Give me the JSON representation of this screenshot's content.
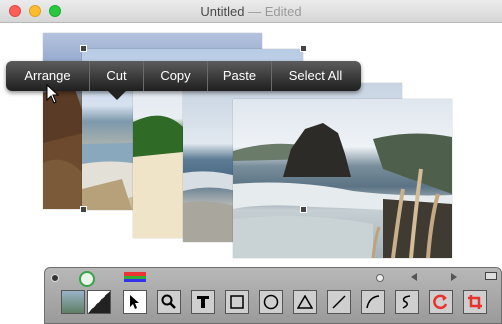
{
  "window": {
    "title": "Untitled",
    "separator": "—",
    "status": "Edited"
  },
  "context_menu": {
    "items": [
      "Arrange",
      "Cut",
      "Copy",
      "Paste",
      "Select All"
    ]
  },
  "toolbox": {
    "tools": [
      "thumbnail",
      "fill-swatch",
      "pointer",
      "magnifier",
      "text",
      "rectangle",
      "oval",
      "triangle",
      "line",
      "arc",
      "freehand",
      "rotate",
      "crop"
    ],
    "active_tool": "pointer"
  },
  "colors": {
    "menu_bg": "#2a2a2a",
    "toolbox_bg": "#a9a9a9",
    "rotate_red": "#e8342c"
  }
}
